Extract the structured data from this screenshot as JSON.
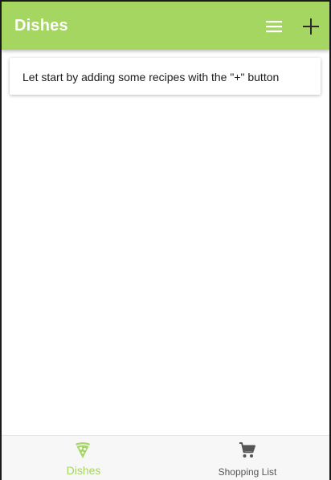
{
  "app_bar": {
    "title": "Dishes",
    "menu_icon": "menu-icon",
    "add_icon": "plus-icon"
  },
  "empty_card": {
    "text": "Let start by adding some recipes with the \"+\" button"
  },
  "bottom_nav": {
    "items": [
      {
        "label": "Dishes",
        "icon": "pizza-slice-icon",
        "active": true
      },
      {
        "label": "Shopping List",
        "icon": "shopping-cart-icon",
        "active": false
      }
    ]
  },
  "colors": {
    "accent": "#a5d662",
    "title_text": "#ffffff",
    "inactive_nav": "#555555"
  }
}
